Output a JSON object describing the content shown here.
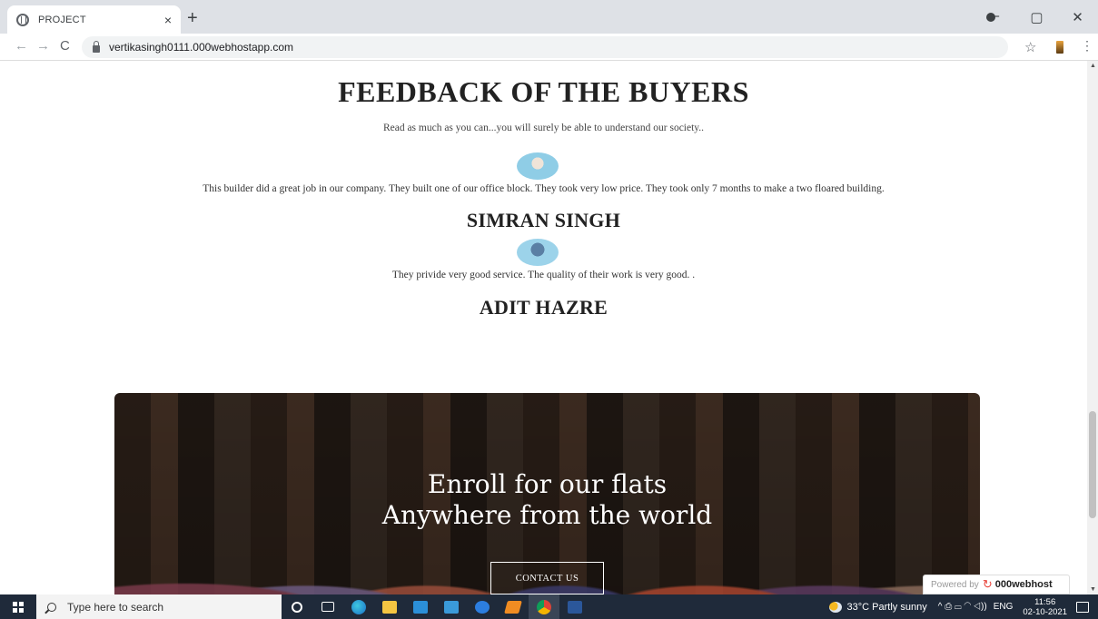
{
  "browser": {
    "tab_title": "PROJECT",
    "tab_close": "×",
    "new_tab": "+",
    "url": "vertikasingh0111.000webhostapp.com",
    "back": "←",
    "forward": "→",
    "reload": "C",
    "star": "☆",
    "menu": "⋮",
    "minimize": "−",
    "maximize": "▢",
    "close": "✕"
  },
  "page": {
    "heading": "FEEDBACK OF THE BUYERS",
    "subheading": "Read as much as you can...you will surely be able to understand our society..",
    "testimonials": [
      {
        "quote": "This builder did a great job in our company. They built one of our office block. They took very low price. They took only 7 months to make a two floared building.",
        "name": "SIMRAN SINGH"
      },
      {
        "quote": "They privide very good service. The quality of their work is very good. .",
        "name": "ADIT HAZRE"
      }
    ],
    "banner": {
      "line1": "Enroll for our flats",
      "line2": "Anywhere from the world",
      "button": "CONTACT US"
    },
    "powered_by": {
      "label": "Powered by",
      "brand": "000webhost"
    }
  },
  "taskbar": {
    "search_placeholder": "Type here to search",
    "weather": "33°C  Partly sunny",
    "tray_icons": "^  ⎙  ▭  ◠  ◁))",
    "lang": "ENG",
    "time": "11:56",
    "date": "02-10-2021"
  },
  "colors": {
    "taskbar": "#1f2a3a",
    "tabstrip": "#dee1e6",
    "accent_logo": "#e8453c"
  }
}
